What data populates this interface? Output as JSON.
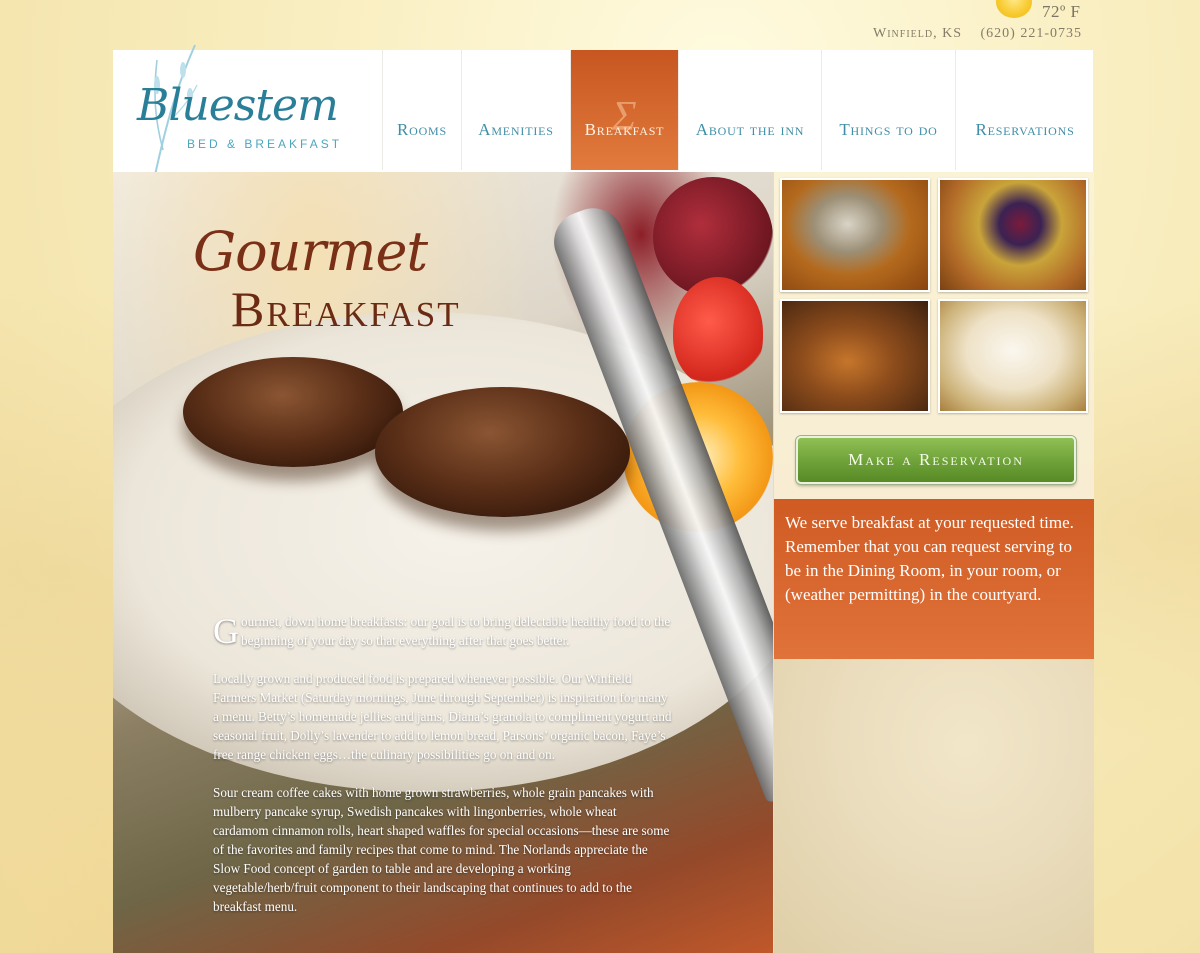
{
  "top": {
    "temperature": "72º F",
    "location": "Winfield, KS",
    "phone": "(620) 221-0735"
  },
  "logo": {
    "name": "Bluestem",
    "tagline": "BED & BREAKFAST"
  },
  "nav": {
    "items": [
      {
        "label": "Rooms",
        "active": false
      },
      {
        "label": "Amenities",
        "active": false
      },
      {
        "label": "Breakfast",
        "active": true
      },
      {
        "label": "About the inn",
        "active": false
      },
      {
        "label": "Things to do",
        "active": false
      },
      {
        "label": "Reservations",
        "active": false
      }
    ]
  },
  "hero": {
    "title_script": "Gourmet",
    "title_main": "Breakfast",
    "dropcap": "G",
    "para1": "ourmet, down home breakfasts: our goal is to bring delectable healthy food to the beginning of your day so that everything after that goes better.",
    "para2": "Locally grown and produced food is prepared whenever possible. Our Winfield Farmers Market (Saturday mornings, June through September) is inspiration for many a menu. Betty’s homemade jellies and jams, Diana’s granola to compliment yogurt and seasonal fruit, Dolly’s lavender to add to lemon bread, Parsons’ organic bacon, Faye’s free range chicken eggs…the culinary possibilities go on and on.",
    "para3": "Sour cream coffee cakes with home grown strawberries, whole grain pancakes with mulberry pancake syrup, Swedish pancakes with lingonberries, whole wheat cardamom cinnamon rolls, heart shaped waffles for special occasions—these are some of the favorites and family recipes that come to mind. The Norlands appreciate the Slow Food concept of garden to table and are developing a working vegetable/herb/fruit component to their landscaping that continues to add to the breakfast menu."
  },
  "side": {
    "reservation_button": "Make a Reservation",
    "info_text": "We serve breakfast at your requested time. Remember that you can request serving to be in the Dining Room, in your room, or (weather permitting) in the courtyard."
  },
  "colors": {
    "accent_orange": "#d45f25",
    "nav_blue": "#3f8ea8",
    "button_green": "#6ea138",
    "title_brown": "#6b2a13"
  }
}
